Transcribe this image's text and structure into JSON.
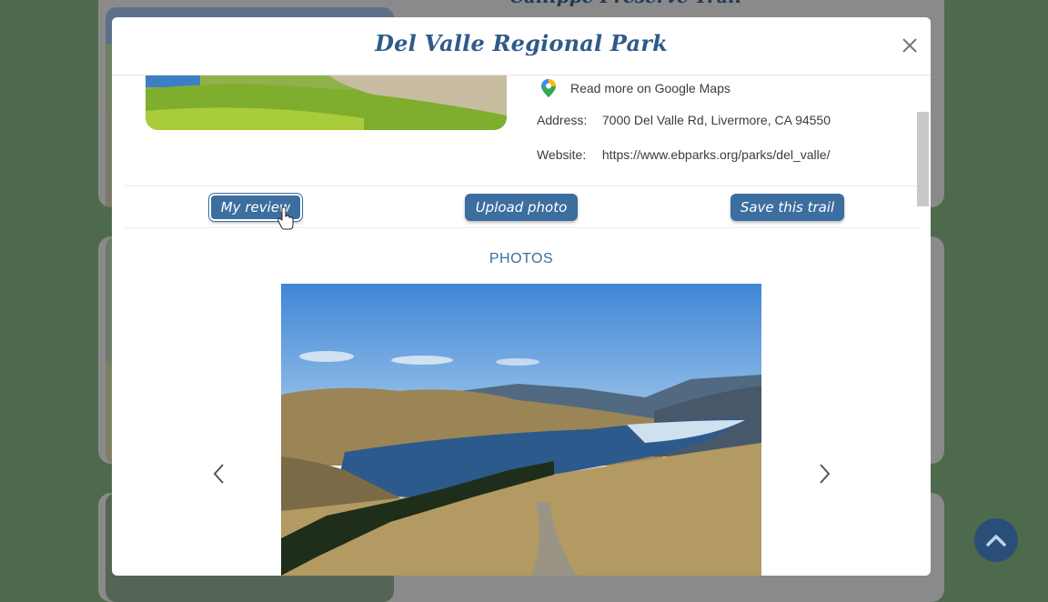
{
  "background": {
    "card_title": "Callippe Preserve Trail"
  },
  "modal": {
    "title": "Del Valle Regional Park",
    "close_icon": "close-icon",
    "maps_link": "Read more on Google Maps",
    "address_label": "Address:",
    "address_value": "7000 Del Valle Rd, Livermore, CA 94550",
    "website_label": "Website:",
    "website_value": "https://www.ebparks.org/parks/del_valle/",
    "buttons": {
      "review": "My review",
      "upload": "Upload photo",
      "save": "Save this trail"
    },
    "photos_title": "PHOTOS"
  },
  "colors": {
    "accent": "#3c6e9f",
    "title": "#2f5b8a",
    "page_bg": "#4e6a4c"
  },
  "icons": {
    "maps": "google-maps-pin-icon",
    "prev": "chevron-left-icon",
    "next": "chevron-right-icon",
    "scroll_top": "chevron-up-icon"
  }
}
